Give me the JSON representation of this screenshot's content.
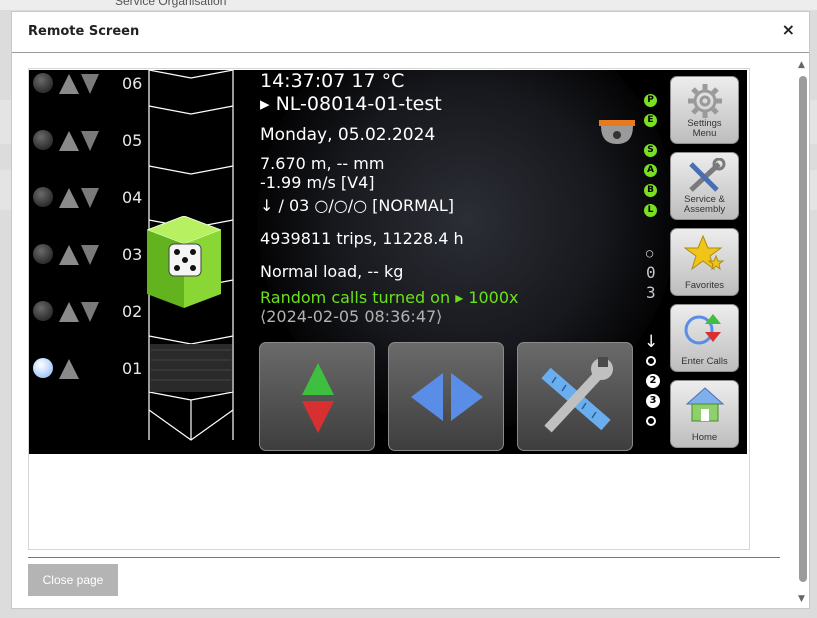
{
  "background": {
    "partial_text": "Service Organisation"
  },
  "modal": {
    "title": "Remote Screen",
    "close_icon": "×",
    "close_page_label": "Close page",
    "scroll_up_glyph": "▲",
    "scroll_down_glyph": "▼"
  },
  "screen": {
    "floors": [
      {
        "number": "06",
        "buttons": "up-down",
        "active": false
      },
      {
        "number": "05",
        "buttons": "up-down",
        "active": false
      },
      {
        "number": "04",
        "buttons": "up-down",
        "active": false
      },
      {
        "number": "03",
        "buttons": "up-down",
        "active": false
      },
      {
        "number": "02",
        "buttons": "up-down",
        "active": false
      },
      {
        "number": "01",
        "buttons": "up",
        "active": true
      }
    ],
    "car_floor": "03",
    "time_temp": "14:37:07  17 °C",
    "device_id": "▸ NL-08014-01-test",
    "date": "Monday, 05.02.2024",
    "position": "7.670 m, -- mm",
    "speed": "-1.99 m/s [V4]",
    "status_line": "↓ / 03  ○/○/○      [NORMAL]",
    "trips": "4939811 trips, 11228.4 h",
    "load": "Normal load, -- kg",
    "random_calls": "Random calls turned on ▸ 1000x",
    "timestamp": "⟨2024-02-05  08:36:47⟩",
    "status_letters": [
      "P",
      "E",
      "S",
      "A",
      "B",
      "L"
    ],
    "door_indicator": [
      "○",
      "0",
      "3"
    ],
    "call_direction": "↓",
    "calls": [
      {
        "label": "",
        "filled": false
      },
      {
        "label": "2",
        "filled": true
      },
      {
        "label": "3",
        "filled": true
      },
      {
        "label": "",
        "filled": false
      }
    ],
    "side_buttons": [
      {
        "icon": "gear-icon",
        "label_1": "Settings",
        "label_2": "Menu"
      },
      {
        "icon": "tools-icon",
        "label_1": "Service &",
        "label_2": "Assembly"
      },
      {
        "icon": "star-icon",
        "label_1": "Favorites",
        "label_2": ""
      },
      {
        "icon": "enter-calls-icon",
        "label_1": "Enter Calls",
        "label_2": ""
      },
      {
        "icon": "home-icon",
        "label_1": "Home",
        "label_2": ""
      }
    ],
    "bottom_buttons": [
      "up-down-arrows-icon",
      "left-right-arrows-icon",
      "tools-icon"
    ]
  },
  "colors": {
    "accent_green": "#6ae21a",
    "lift_car_green": "#7ed12a",
    "arrow_green": "#3fbf3f",
    "arrow_red": "#d83030",
    "arrow_blue": "#5a8ee6",
    "camera_orange": "#e87a1e"
  }
}
